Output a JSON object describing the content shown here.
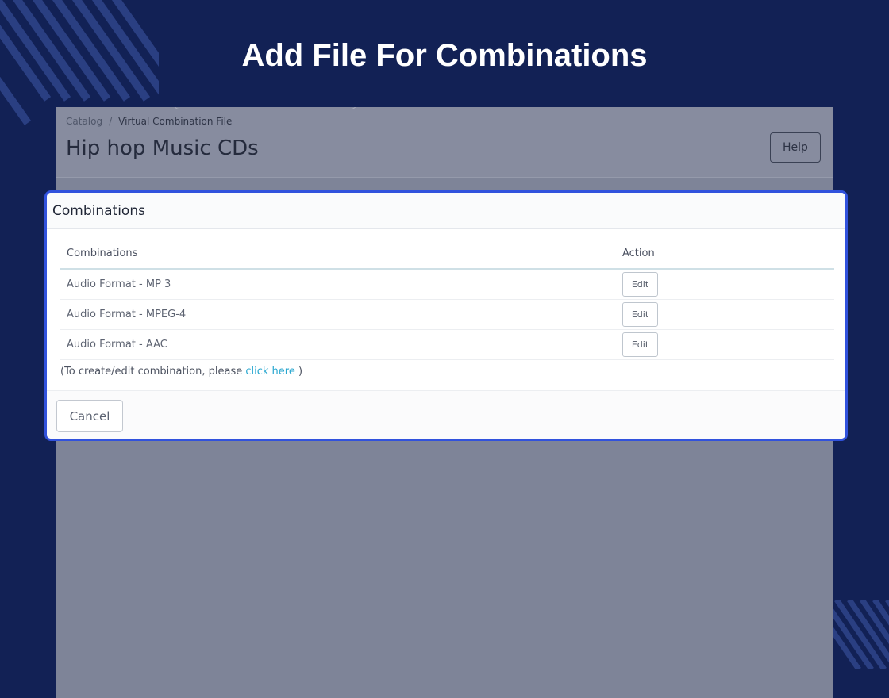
{
  "hero": {
    "title": "Add File For Combinations"
  },
  "background_page": {
    "breadcrumb": {
      "root": "Catalog",
      "separator": "/",
      "current": "Virtual Combination File"
    },
    "title": "Hip hop Music CDs",
    "help_label": "Help"
  },
  "modal": {
    "title": "Combinations",
    "table": {
      "headers": [
        "Combinations",
        "Action"
      ],
      "rows": [
        {
          "name": "Audio Format - MP 3",
          "action": "Edit"
        },
        {
          "name": "Audio Format - MPEG-4",
          "action": "Edit"
        },
        {
          "name": "Audio Format - AAC",
          "action": "Edit"
        }
      ]
    },
    "note": {
      "prefix": "(To create/edit combination, please ",
      "link": "click here",
      "suffix": " )"
    },
    "cancel_label": "Cancel"
  },
  "colors": {
    "page_background": "#122155",
    "stripe_color": "#2a3f82",
    "modal_border": "#3152dd",
    "link": "#27a6cf",
    "overlay": "#7e8498"
  },
  "icons": {
    "decor_top_left": "diagonal-stripes",
    "decor_bottom_right": "diagonal-stripes"
  }
}
